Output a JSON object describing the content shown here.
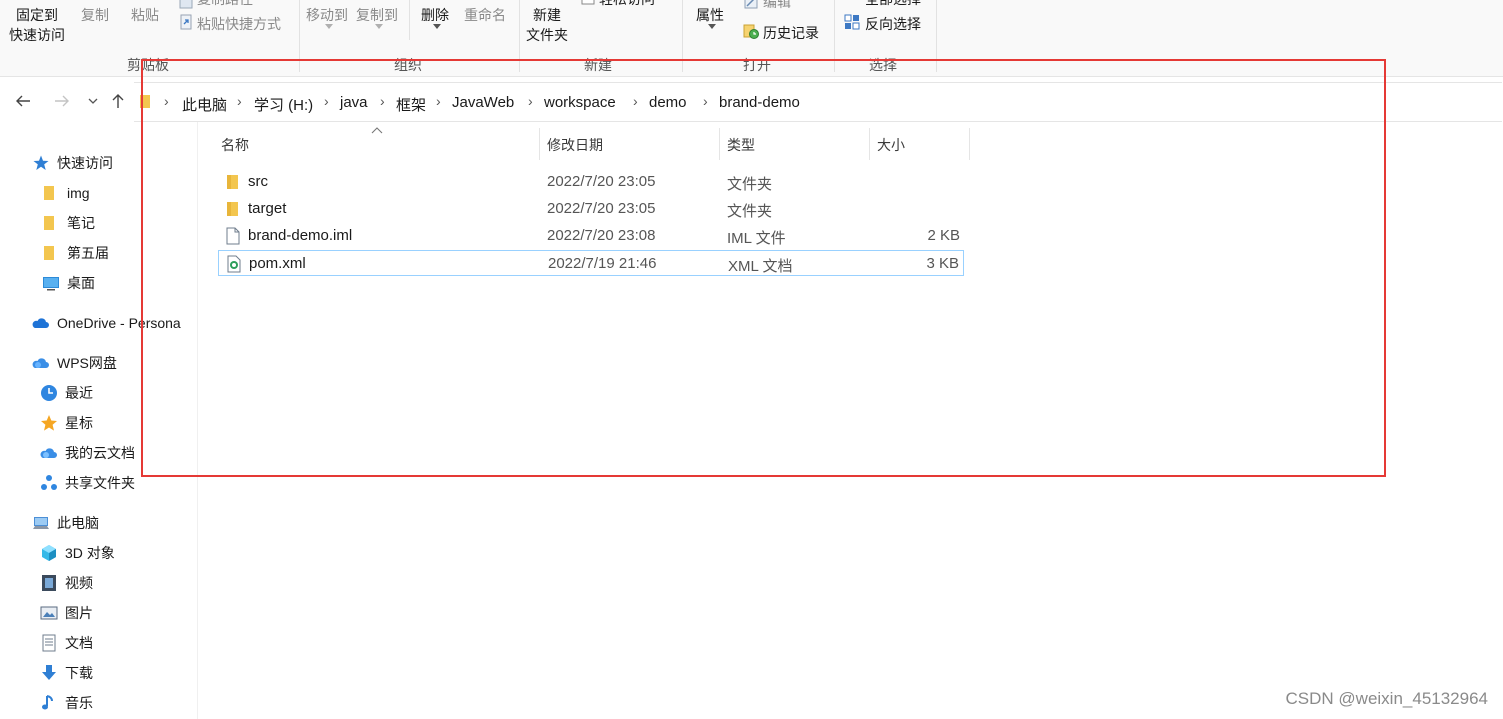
{
  "ribbon": {
    "clipboard": {
      "pin_line1": "固定到",
      "pin_line2": "快速访问",
      "copy": "复制",
      "paste": "粘贴",
      "copy_path": "复制路径",
      "paste_shortcut": "粘贴快捷方式",
      "group_label": "剪贴板"
    },
    "organize": {
      "move_to": "移动到",
      "copy_to": "复制到",
      "delete": "删除",
      "rename": "重命名",
      "group_label": "组织"
    },
    "new": {
      "new_folder_line1": "新建",
      "new_folder_line2": "文件夹",
      "easy_access": "轻松访问",
      "group_label": "新建"
    },
    "open": {
      "properties": "属性",
      "edit": "编辑",
      "history": "历史记录",
      "group_label": "打开"
    },
    "select": {
      "select_all": "全部选择",
      "invert_selection": "反向选择",
      "group_label": "选择"
    }
  },
  "breadcrumb": [
    "此电脑",
    "学习 (H:)",
    "java",
    "框架",
    "JavaWeb",
    "workspace",
    "demo",
    "brand-demo"
  ],
  "sidebar": {
    "quick_access": "快速访问",
    "quick_items": [
      "img",
      "笔记",
      "第五届",
      "桌面"
    ],
    "onedrive": "OneDrive - Persona",
    "wps": "WPS网盘",
    "wps_items": [
      "最近",
      "星标",
      "我的云文档",
      "共享文件夹"
    ],
    "this_pc": "此电脑",
    "pc_items": [
      "3D 对象",
      "视频",
      "图片",
      "文档",
      "下载",
      "音乐"
    ]
  },
  "columns": {
    "name": "名称",
    "date": "修改日期",
    "type": "类型",
    "size": "大小"
  },
  "files": [
    {
      "name": "src",
      "date": "2022/7/20 23:05",
      "type": "文件夹",
      "size": "",
      "icon": "folder-icon"
    },
    {
      "name": "target",
      "date": "2022/7/20 23:05",
      "type": "文件夹",
      "size": "",
      "icon": "folder-icon"
    },
    {
      "name": "brand-demo.iml",
      "date": "2022/7/20 23:08",
      "type": "IML 文件",
      "size": "2 KB",
      "icon": "file-icon"
    },
    {
      "name": "pom.xml",
      "date": "2022/7/19 21:46",
      "type": "XML 文档",
      "size": "3 KB",
      "icon": "xml-file-icon"
    }
  ],
  "watermark": "CSDN @weixin_45132964",
  "colors": {
    "annotation_box": "#e53935",
    "selection_border": "#99d1ff",
    "folder": "#f3c64f"
  }
}
